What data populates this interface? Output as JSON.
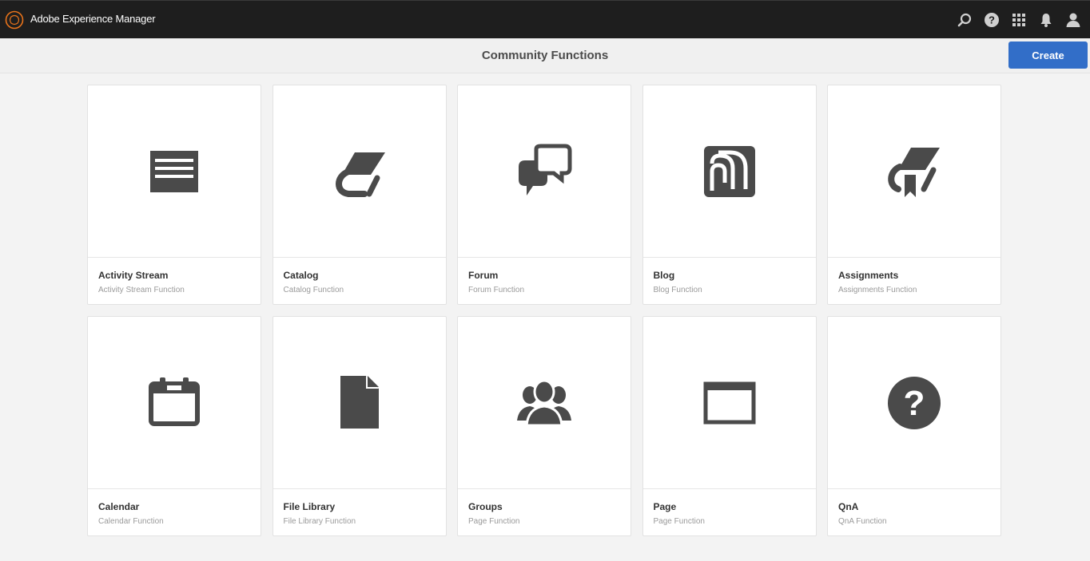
{
  "header": {
    "app_title": "Adobe Experience Manager",
    "icons": [
      "search-icon",
      "help-icon",
      "solutions-grid-icon",
      "notifications-icon",
      "user-icon"
    ]
  },
  "actionbar": {
    "title": "Community Functions",
    "create_label": "Create",
    "accent_color": "#326ec8"
  },
  "cards": [
    {
      "title": "Activity Stream",
      "subtitle": "Activity Stream Function",
      "icon": "activity-stream-icon"
    },
    {
      "title": "Catalog",
      "subtitle": "Catalog Function",
      "icon": "catalog-icon"
    },
    {
      "title": "Forum",
      "subtitle": "Forum Function",
      "icon": "forum-icon"
    },
    {
      "title": "Blog",
      "subtitle": "Blog Function",
      "icon": "blog-icon"
    },
    {
      "title": "Assignments",
      "subtitle": "Assignments Function",
      "icon": "assignments-icon"
    },
    {
      "title": "Calendar",
      "subtitle": "Calendar Function",
      "icon": "calendar-icon"
    },
    {
      "title": "File Library",
      "subtitle": "File Library Function",
      "icon": "file-library-icon"
    },
    {
      "title": "Groups",
      "subtitle": "Page Function",
      "icon": "groups-icon"
    },
    {
      "title": "Page",
      "subtitle": "Page Function",
      "icon": "page-icon"
    },
    {
      "title": "QnA",
      "subtitle": "QnA Function",
      "icon": "qna-icon"
    }
  ]
}
